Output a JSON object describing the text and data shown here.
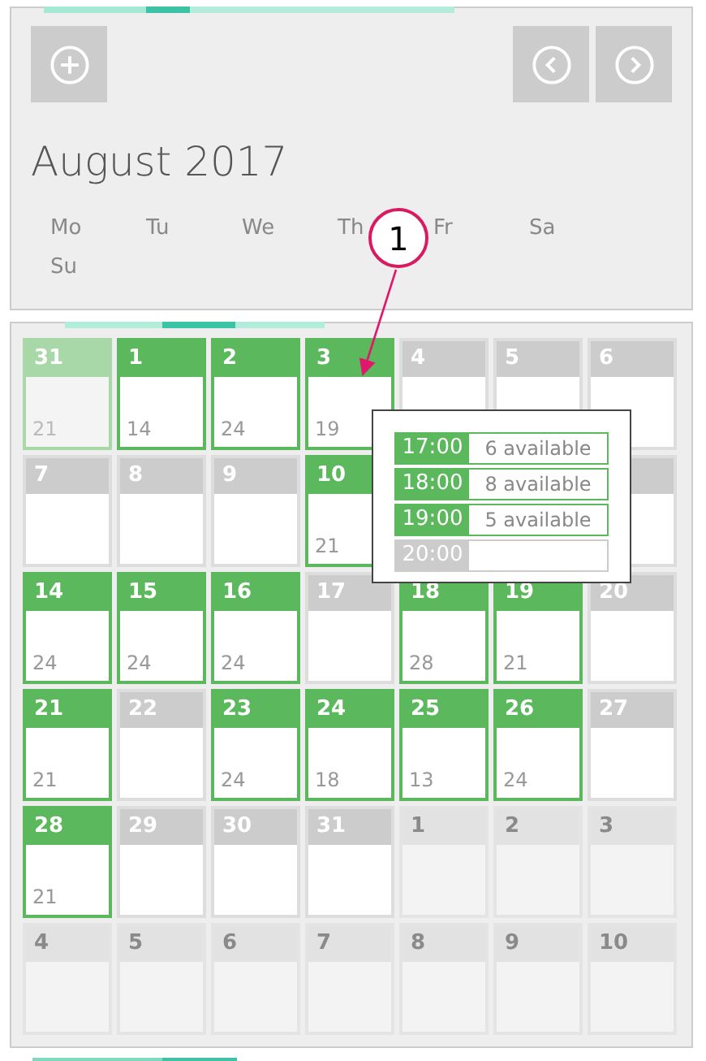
{
  "month_title": "August 2017",
  "weekdays": [
    "Mo",
    "Tu",
    "We",
    "Th",
    "Fr",
    "Sa",
    "Su"
  ],
  "days": [
    {
      "day": "31",
      "kind": "past",
      "count": "21"
    },
    {
      "day": "1",
      "kind": "available",
      "count": "14"
    },
    {
      "day": "2",
      "kind": "available",
      "count": "24"
    },
    {
      "day": "3",
      "kind": "available",
      "count": "19"
    },
    {
      "day": "4",
      "kind": "closed"
    },
    {
      "day": "5",
      "kind": "closed"
    },
    {
      "day": "6",
      "kind": "closed"
    },
    {
      "day": "7",
      "kind": "closed"
    },
    {
      "day": "8",
      "kind": "closed"
    },
    {
      "day": "9",
      "kind": "closed"
    },
    {
      "day": "10",
      "kind": "available",
      "count": "21"
    },
    {
      "kind": "hidden"
    },
    {
      "kind": "hidden"
    },
    {
      "kind": "closed"
    },
    {
      "day": "14",
      "kind": "available",
      "count": "24"
    },
    {
      "day": "15",
      "kind": "available",
      "count": "24"
    },
    {
      "day": "16",
      "kind": "available",
      "count": "24"
    },
    {
      "day": "17",
      "kind": "closed"
    },
    {
      "day": "18",
      "kind": "available",
      "count": "28"
    },
    {
      "day": "19",
      "kind": "available",
      "count": "21"
    },
    {
      "day": "20",
      "kind": "closed"
    },
    {
      "day": "21",
      "kind": "available",
      "count": "21"
    },
    {
      "day": "22",
      "kind": "closed"
    },
    {
      "day": "23",
      "kind": "available",
      "count": "24"
    },
    {
      "day": "24",
      "kind": "available",
      "count": "18"
    },
    {
      "day": "25",
      "kind": "available",
      "count": "13"
    },
    {
      "day": "26",
      "kind": "available",
      "count": "24"
    },
    {
      "day": "27",
      "kind": "closed"
    },
    {
      "day": "28",
      "kind": "available",
      "count": "21"
    },
    {
      "day": "29",
      "kind": "closed"
    },
    {
      "day": "30",
      "kind": "closed"
    },
    {
      "day": "31",
      "kind": "closed"
    },
    {
      "day": "1",
      "kind": "other"
    },
    {
      "day": "2",
      "kind": "other"
    },
    {
      "day": "3",
      "kind": "other"
    },
    {
      "day": "4",
      "kind": "other"
    },
    {
      "day": "5",
      "kind": "other"
    },
    {
      "day": "6",
      "kind": "other"
    },
    {
      "day": "7",
      "kind": "other"
    },
    {
      "day": "8",
      "kind": "other"
    },
    {
      "day": "9",
      "kind": "other"
    },
    {
      "day": "10",
      "kind": "other"
    }
  ],
  "popover": {
    "slots": [
      {
        "time": "17:00",
        "kind": "available",
        "text": "6 available"
      },
      {
        "time": "18:00",
        "kind": "available",
        "text": "8 available"
      },
      {
        "time": "19:00",
        "kind": "available",
        "text": "5 available"
      },
      {
        "time": "20:00",
        "kind": "unavailable"
      }
    ]
  },
  "callout": {
    "label": "1"
  }
}
